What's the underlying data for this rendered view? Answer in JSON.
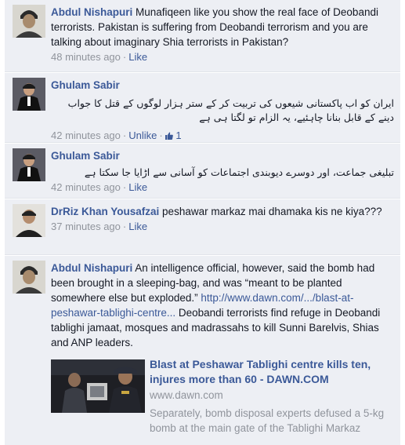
{
  "comments": [
    {
      "author": "Abdul Nishapuri",
      "text": "Munafiqeen like you show the real face of Deobandi terrorists. Pakistan is suffering from Deobandi terrorism and you are talking about imaginary Shia terrorists in Pakistan?",
      "time": "48 minutes ago",
      "action": "Like"
    },
    {
      "author": "Ghulam Sabir",
      "text": "ایران کو اب پاکستانی شیعوں کی تربیت کر کے ستر ہزار لوگوں کے قتل کا جواب دینے کے قابل بنانا چاہئیے، یہ الزام تو لگتا ہی ہے",
      "time": "42 minutes ago",
      "action": "Unlike",
      "likes": "1"
    },
    {
      "author": "Ghulam Sabir",
      "text": "تبلیغی جماعت، اور دوسرے دیوبندی اجتماعات کو آسانی سے اڑایا جا سکتا ہے",
      "time": "42 minutes ago",
      "action": "Like"
    },
    {
      "author": "DrRiz Khan Yousafzai",
      "text": "peshawar markaz mai dhamaka kis ne kiya???",
      "time": "37 minutes ago",
      "action": "Like"
    },
    {
      "author": "Abdul Nishapuri",
      "text_before": "An intelligence official, however, said the bomb had been brought in a sleeping-bag, and was “meant to be planted somewhere else but exploded.”",
      "link": "http://www.dawn.com/.../blast-at-peshawar-tablighi-centre...",
      "text_after": "Deobandi terrorists find refuge in Deobandi tablighi jamaat, mosques and madrassahs to kill Sunni Barelvis, Shias and ANP leaders.",
      "attachment": {
        "title": "Blast at Peshawar Tablighi centre kills ten, injures more than 60 - DAWN.COM",
        "domain": "www.dawn.com",
        "description": "Separately, bomb disposal experts defused a 5-kg bomb at the main gate of the Tablighi Markaz"
      }
    }
  ],
  "icons": {
    "like_count": "thumbs-up-icon"
  },
  "colors": {
    "link": "#3b5998",
    "meta": "#90949c",
    "background": "#edeff4"
  }
}
